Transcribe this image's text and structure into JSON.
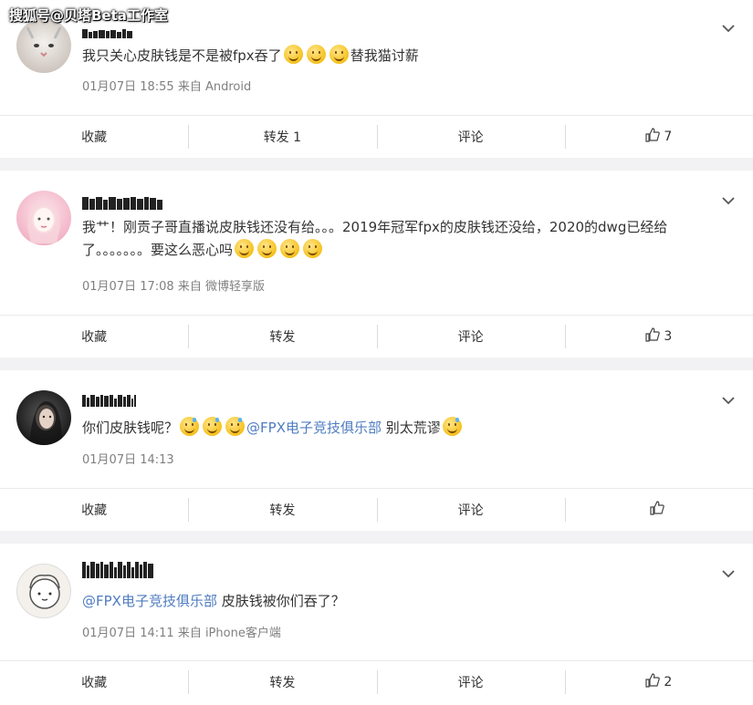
{
  "watermark": "搜狐号@贝塔Beta工作室",
  "comments": [
    {
      "content_parts": [
        {
          "t": "text",
          "v": "我只关心皮肤钱是不是被fpx吞了"
        },
        {
          "t": "emoji"
        },
        {
          "t": "emoji"
        },
        {
          "t": "emoji"
        },
        {
          "t": "text",
          "v": "替我猫讨薪"
        }
      ],
      "meta": "01月07日 18:55  来自 Android",
      "actions": {
        "collect": "收藏",
        "repost": "转发 1",
        "comment": "评论",
        "like": "7"
      }
    },
    {
      "content_parts": [
        {
          "t": "text",
          "v": "我艹！刚贡子哥直播说皮肤钱还没有给。。。2019年冠军fpx的皮肤钱还没给，2020的dwg已经给了。。。。。。。要这么恶心吗"
        },
        {
          "t": "emoji"
        },
        {
          "t": "emoji"
        },
        {
          "t": "emoji"
        },
        {
          "t": "emoji"
        }
      ],
      "meta": "01月07日 17:08  来自 微博轻享版",
      "actions": {
        "collect": "收藏",
        "repost": "转发",
        "comment": "评论",
        "like": "3"
      }
    },
    {
      "content_parts": [
        {
          "t": "text",
          "v": "你们皮肤钱呢？"
        },
        {
          "t": "sweat"
        },
        {
          "t": "sweat"
        },
        {
          "t": "sweat"
        },
        {
          "t": "mention",
          "v": "@FPX电子竞技俱乐部"
        },
        {
          "t": "text",
          "v": " 别太荒谬"
        },
        {
          "t": "sweat"
        }
      ],
      "meta": "01月07日 14:13",
      "actions": {
        "collect": "收藏",
        "repost": "转发",
        "comment": "评论",
        "like": ""
      }
    },
    {
      "content_parts": [
        {
          "t": "mention",
          "v": "@FPX电子竞技俱乐部"
        },
        {
          "t": "text",
          "v": " 皮肤钱被你们吞了？"
        }
      ],
      "meta": "01月07日 14:11  来自 iPhone客户端",
      "actions": {
        "collect": "收藏",
        "repost": "转发",
        "comment": "评论",
        "like": "2"
      }
    }
  ],
  "colors": {
    "mention": "#4f7cc0",
    "meta": "#808080",
    "bg": "#f2f2f5"
  }
}
